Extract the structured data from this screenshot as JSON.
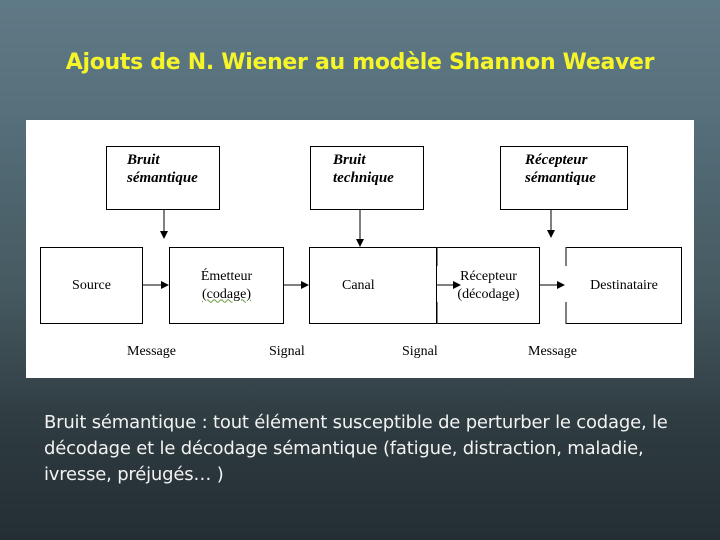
{
  "slide": {
    "title": "Ajouts de N. Wiener au modèle Shannon Weaver",
    "caption": "Bruit sémantique : tout élément susceptible de perturber le codage, le décodage et le décodage sémantique (fatigue, distraction, maladie, ivresse, préjugés… )"
  },
  "diagram": {
    "noise_boxes": [
      {
        "line1": "Bruit",
        "line2": "sémantique"
      },
      {
        "line1": "Bruit",
        "line2": "technique"
      },
      {
        "line1": "Récepteur",
        "line2": "sémantique"
      }
    ],
    "process_boxes": [
      {
        "line1": "Source",
        "line2": ""
      },
      {
        "line1": "Émetteur",
        "line2": "(codage)"
      },
      {
        "line1": "Canal",
        "line2": ""
      },
      {
        "line1": "Récepteur",
        "line2": "(décodage)"
      },
      {
        "line1": "Destinataire",
        "line2": ""
      }
    ],
    "flow_labels": [
      "Message",
      "Signal",
      "Signal",
      "Message"
    ]
  }
}
